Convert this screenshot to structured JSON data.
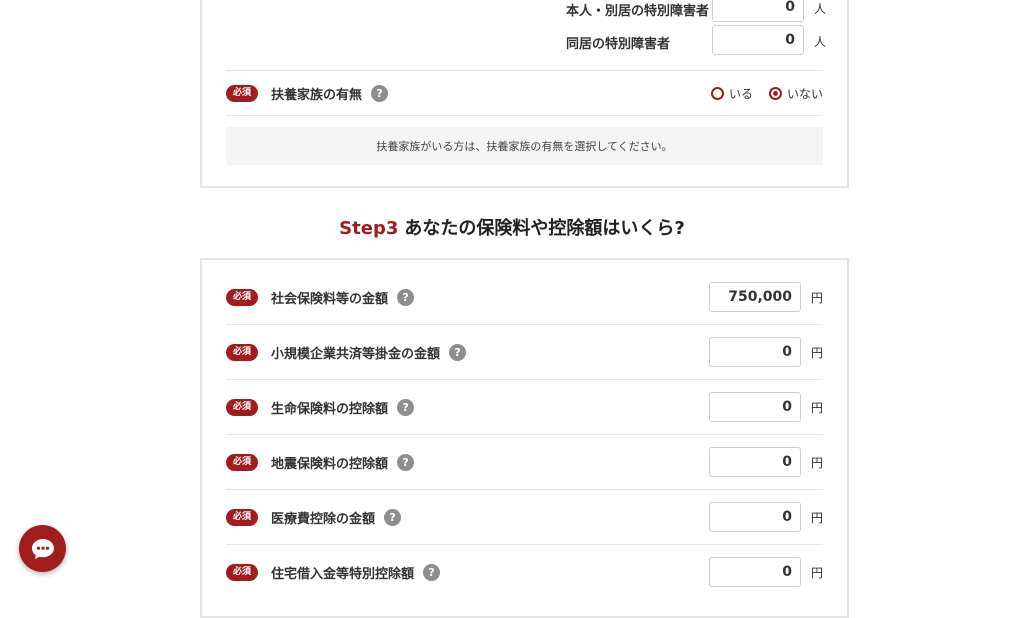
{
  "top_card": {
    "disabled_rows": [
      {
        "label": "本人・別居の特別障害者",
        "value": "0",
        "unit": "人"
      },
      {
        "label": "同居の特別障害者",
        "value": "0",
        "unit": "人"
      }
    ],
    "dependents": {
      "required_badge": "必須",
      "label": "扶養家族の有無",
      "help": "?",
      "options": [
        {
          "label": "いる",
          "selected": false
        },
        {
          "label": "いない",
          "selected": true
        }
      ]
    },
    "notice": "扶養家族がいる方は、扶養家族の有無を選択してください。"
  },
  "step3": {
    "step_label": "Step3",
    "title": "あなたの保険料や控除額はいくら?"
  },
  "deduction_rows": [
    {
      "badge": "必須",
      "label": "社会保険料等の金額",
      "help": "?",
      "value": "750,000",
      "unit": "円"
    },
    {
      "badge": "必須",
      "label": "小規模企業共済等掛金の金額",
      "help": "?",
      "value": "0",
      "unit": "円"
    },
    {
      "badge": "必須",
      "label": "生命保険料の控除額",
      "help": "?",
      "value": "0",
      "unit": "円"
    },
    {
      "badge": "必須",
      "label": "地震保険料の控除額",
      "help": "?",
      "value": "0",
      "unit": "円"
    },
    {
      "badge": "必須",
      "label": "医療費控除の金額",
      "help": "?",
      "value": "0",
      "unit": "円"
    },
    {
      "badge": "必須",
      "label": "住宅借入金等特別控除額",
      "help": "?",
      "value": "0",
      "unit": "円"
    }
  ],
  "colors": {
    "accent": "#a11c1c",
    "help": "#8e8e8e",
    "border": "#e4e4e4",
    "notice_bg": "#f4f4f4"
  },
  "icons": {
    "chat": "chat-bubble-icon",
    "help": "question-icon"
  }
}
